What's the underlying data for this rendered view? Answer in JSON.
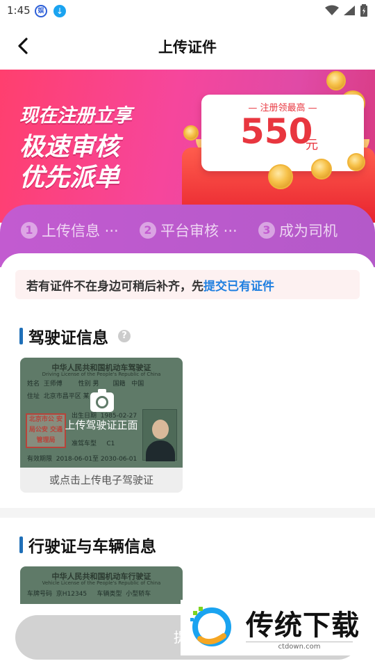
{
  "status_bar": {
    "time": "1:45",
    "app_icon_1": "娱",
    "app_icon_2": "↓"
  },
  "header": {
    "title": "上传证件"
  },
  "banner": {
    "slogan_line1": "现在注册立享",
    "slogan_line2": "极速审核",
    "slogan_line3": "优先派单",
    "card_subtitle": "— 注册领最高 —",
    "amount": "550",
    "unit": "元"
  },
  "steps": [
    {
      "num": "1",
      "label": "上传信息 ···"
    },
    {
      "num": "2",
      "label": "平台审核 ···"
    },
    {
      "num": "3",
      "label": "成为司机"
    }
  ],
  "notice": {
    "text": "若有证件不在身边可稍后补齐，先",
    "link": "提交已有证件"
  },
  "driver_license": {
    "section_title": "驾驶证信息",
    "help": "?",
    "card_title": "中华人民共和国机动车驾驶证",
    "card_title_en": "Driving License of the People's Republic of China",
    "row_name_label": "姓名",
    "name": "王师傅",
    "row_gender_label": "性别",
    "gender": "男",
    "row_nationality_label": "国籍",
    "nationality": "中国",
    "row_address_label": "住址",
    "address": "北京市昌平区 某 社区",
    "birth_label": "出生日期",
    "birth": "1985-02-27",
    "class_label": "准驾车型",
    "class": "C1",
    "validity_label": "有效期限",
    "validity": "2018-06-01至 2030-06-01",
    "stamp": "北京市公 安局公安 交通管理局",
    "upload_label": "上传驾驶证正面",
    "alt_upload": "或点击上传电子驾驶证"
  },
  "vehicle_license": {
    "section_title": "行驶证与车辆信息",
    "card_title": "中华人民共和国机动车行驶证",
    "card_title_en": "Vehicle License of the People's Republic of China",
    "plate_label": "车牌号码",
    "plate": "京H12345",
    "type_label": "车辆类型",
    "type": "小型轿车"
  },
  "submit": {
    "label": "提交"
  },
  "watermark": {
    "text": "传统下载",
    "url": "ctdown.com"
  },
  "colors": {
    "accent_link": "#1f7fe0",
    "banner_pink": "#f6469c",
    "steps_purple": "#c25bd0",
    "amount_red": "#e8363f",
    "section_bar": "#1f6fb8"
  }
}
